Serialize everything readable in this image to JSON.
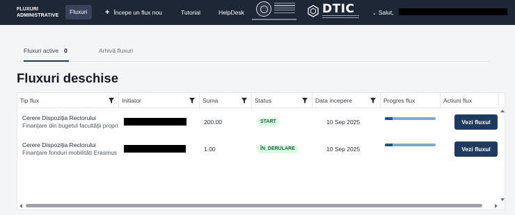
{
  "nav": {
    "brand_line1": "FLUXURI",
    "brand_line2": "ADMINISTRATIVE",
    "items": [
      {
        "label": "Fluxuri"
      },
      {
        "label": "Începe un flux nou"
      },
      {
        "label": "Tutorial"
      },
      {
        "label": "HelpDesk"
      }
    ],
    "plus_icon": "+",
    "dtic_label": "DTIC",
    "greeting": "Salut,"
  },
  "tabs": [
    {
      "label": "Fluxuri active",
      "count": "0"
    },
    {
      "label": "Arhivă fluxuri"
    }
  ],
  "page_title": "Fluxuri deschise",
  "table": {
    "headers": [
      "Tip flux",
      "Initiator",
      "Suma",
      "Status",
      "Data incepere",
      "Progres flux",
      "Actiuni flux"
    ],
    "rows": [
      {
        "tip": "Cerere Dispoziția Rectorului",
        "sub": "Finanțare din bugetul facultății proprii",
        "suma": "200.00",
        "status": "START",
        "data": "10 Sep 2025",
        "progress": 0.15,
        "action": "Vezi fluxul"
      },
      {
        "tip": "Cerere Dispoziția Rectorului",
        "sub": "Finanțare fonduri mobilități Erasmus (a",
        "suma": "1.00",
        "status": "ÎN_DERULARE",
        "data": "10 Sep 2025",
        "progress": 0.15,
        "action": "Vezi fluxul"
      }
    ]
  },
  "colors": {
    "navbar": "#1e2736",
    "accent": "#1e3a5f",
    "progress_fill": "#1d4f91",
    "progress_track": "#7fa7d6",
    "badge_bg": "#dcfce7",
    "badge_text": "#166534"
  }
}
